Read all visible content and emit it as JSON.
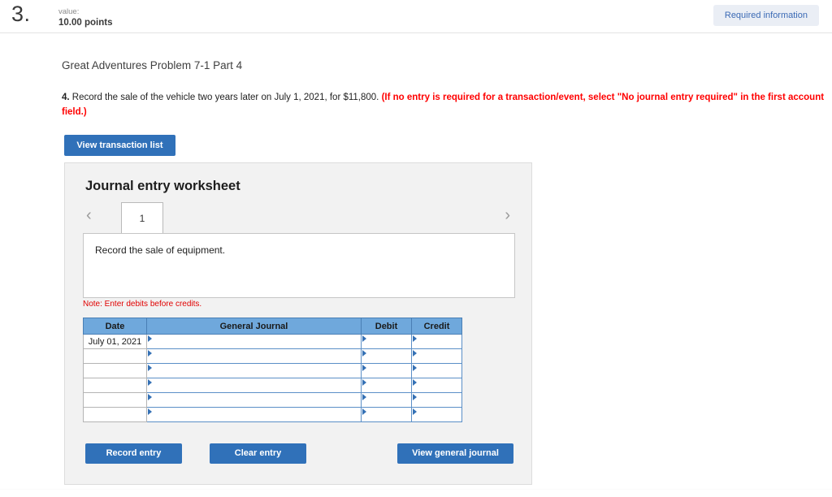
{
  "header": {
    "question_number": "3.",
    "value_label": "value:",
    "points": "10.00 points",
    "required_information_badge": "Required information"
  },
  "problem": {
    "title": "Great Adventures Problem 7-1 Part 4",
    "question_number": "4.",
    "question_body": " Record the sale of the vehicle two years later on July 1, 2021, for $11,800. ",
    "question_hint": "(If no entry is required for a transaction/event, select \"No journal entry required\" in the first account field.)"
  },
  "actions": {
    "view_transaction_list": "View transaction list",
    "record_entry": "Record entry",
    "clear_entry": "Clear entry",
    "view_general_journal": "View general journal"
  },
  "worksheet": {
    "heading": "Journal entry worksheet",
    "prev_icon": "‹",
    "next_icon": "›",
    "tabs": [
      {
        "label": "1",
        "active": true
      }
    ],
    "entry_description": "Record the sale of equipment.",
    "note": "Note: Enter debits before credits."
  },
  "journal_table": {
    "columns": [
      "Date",
      "General Journal",
      "Debit",
      "Credit"
    ],
    "rows": [
      {
        "date": "July 01, 2021",
        "general_journal": "",
        "debit": "",
        "credit": ""
      },
      {
        "date": "",
        "general_journal": "",
        "debit": "",
        "credit": ""
      },
      {
        "date": "",
        "general_journal": "",
        "debit": "",
        "credit": ""
      },
      {
        "date": "",
        "general_journal": "",
        "debit": "",
        "credit": ""
      },
      {
        "date": "",
        "general_journal": "",
        "debit": "",
        "credit": ""
      },
      {
        "date": "",
        "general_journal": "",
        "debit": "",
        "credit": ""
      }
    ]
  },
  "colors": {
    "primary_button": "#3071b9",
    "table_header": "#6fa8dc",
    "hint_red": "#ff0000",
    "badge_bg": "#eaeef5",
    "badge_text": "#3b6ab5",
    "panel_bg": "#f2f2f2"
  }
}
